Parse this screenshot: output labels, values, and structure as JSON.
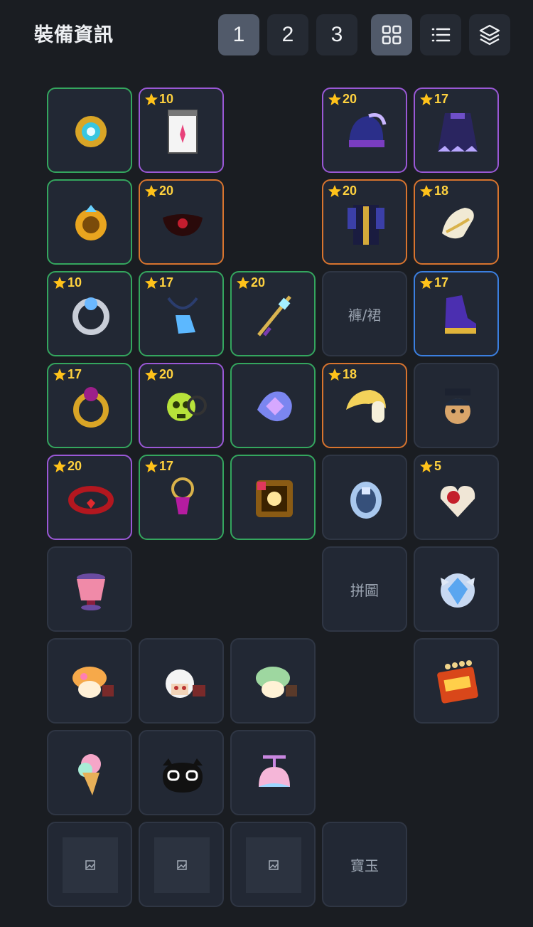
{
  "header": {
    "title": "裝備資訊",
    "pages": [
      "1",
      "2",
      "3"
    ],
    "active_page": "1",
    "view_modes": [
      "grid-icon",
      "list-icon",
      "layers-icon"
    ],
    "active_view": "grid-icon"
  },
  "equipment": {
    "slots": [
      {
        "row": 0,
        "col": 0,
        "border": "green",
        "icon": "emblem-ring-icon"
      },
      {
        "row": 0,
        "col": 1,
        "border": "purple",
        "star": "10",
        "icon": "pocket-paper-icon"
      },
      {
        "row": 0,
        "col": 3,
        "border": "purple",
        "star": "20",
        "icon": "helmet-icon"
      },
      {
        "row": 0,
        "col": 4,
        "border": "purple",
        "star": "17",
        "icon": "cape-icon"
      },
      {
        "row": 1,
        "col": 0,
        "border": "green",
        "icon": "gold-ring-icon"
      },
      {
        "row": 1,
        "col": 1,
        "border": "orange",
        "star": "20",
        "icon": "eye-accessory-icon"
      },
      {
        "row": 1,
        "col": 3,
        "border": "orange",
        "star": "20",
        "icon": "overall-armor-icon"
      },
      {
        "row": 1,
        "col": 4,
        "border": "orange",
        "star": "18",
        "icon": "gloves-icon"
      },
      {
        "row": 2,
        "col": 0,
        "border": "green",
        "star": "10",
        "icon": "silver-ring-icon"
      },
      {
        "row": 2,
        "col": 1,
        "border": "green",
        "star": "17",
        "icon": "pendant-icon"
      },
      {
        "row": 2,
        "col": 2,
        "border": "green",
        "star": "20",
        "icon": "weapon-staff-icon"
      },
      {
        "row": 2,
        "col": 3,
        "border": "none",
        "text": "褲/裙"
      },
      {
        "row": 2,
        "col": 4,
        "border": "blue",
        "star": "17",
        "icon": "shoes-icon"
      },
      {
        "row": 3,
        "col": 0,
        "border": "green",
        "star": "17",
        "icon": "ruby-ring-icon"
      },
      {
        "row": 3,
        "col": 1,
        "border": "purple",
        "star": "20",
        "icon": "skull-earring-icon"
      },
      {
        "row": 3,
        "col": 2,
        "border": "green",
        "icon": "spirit-stone-icon"
      },
      {
        "row": 3,
        "col": 3,
        "border": "orange",
        "star": "18",
        "icon": "shoulder-icon"
      },
      {
        "row": 3,
        "col": 4,
        "border": "none",
        "icon": "android-icon"
      },
      {
        "row": 4,
        "col": 0,
        "border": "purple",
        "star": "20",
        "icon": "belt-icon"
      },
      {
        "row": 4,
        "col": 1,
        "border": "green",
        "star": "17",
        "icon": "amulet-icon"
      },
      {
        "row": 4,
        "col": 2,
        "border": "green",
        "icon": "badge-icon"
      },
      {
        "row": 4,
        "col": 3,
        "border": "none",
        "icon": "heart-mechanical-icon"
      },
      {
        "row": 4,
        "col": 4,
        "border": "none",
        "star": "5",
        "icon": "heart-icon"
      },
      {
        "row": 5,
        "col": 0,
        "border": "none",
        "icon": "pot-totem-icon"
      },
      {
        "row": 5,
        "col": 3,
        "border": "none",
        "text": "拼圖"
      },
      {
        "row": 5,
        "col": 4,
        "border": "none",
        "icon": "medal-icon"
      },
      {
        "row": 6,
        "col": 0,
        "border": "none",
        "icon": "mushroom-pet-icon"
      },
      {
        "row": 6,
        "col": 1,
        "border": "none",
        "icon": "white-hair-pet-icon"
      },
      {
        "row": 6,
        "col": 2,
        "border": "none",
        "icon": "green-mushroom-pet-icon"
      },
      {
        "row": 6,
        "col": 4,
        "border": "none",
        "icon": "exp-calendar-icon"
      },
      {
        "row": 7,
        "col": 0,
        "border": "none",
        "icon": "ice-cream-pet-equip-icon"
      },
      {
        "row": 7,
        "col": 1,
        "border": "none",
        "icon": "black-cat-pet-equip-icon"
      },
      {
        "row": 7,
        "col": 2,
        "border": "none",
        "icon": "propeller-hat-pet-equip-icon"
      },
      {
        "row": 8,
        "col": 0,
        "border": "none",
        "placeholder": true,
        "icon": "broken-image-icon"
      },
      {
        "row": 8,
        "col": 1,
        "border": "none",
        "placeholder": true,
        "icon": "broken-image-icon"
      },
      {
        "row": 8,
        "col": 2,
        "border": "none",
        "placeholder": true,
        "icon": "broken-image-icon"
      },
      {
        "row": 8,
        "col": 3,
        "border": "none",
        "text": "寶玉"
      }
    ]
  }
}
